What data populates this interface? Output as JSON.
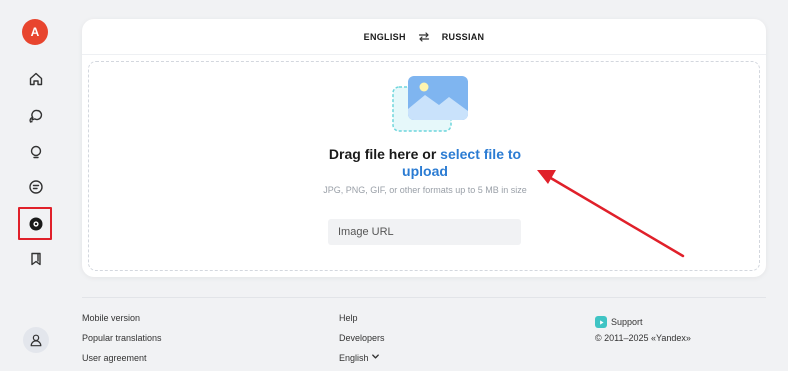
{
  "app": {
    "logo_text": "A"
  },
  "sidebar": {
    "items": [
      {
        "name": "home",
        "icon": "home-icon"
      },
      {
        "name": "text-translation",
        "icon": "chat-bubbles-icon"
      },
      {
        "name": "dialog",
        "icon": "lightbulb-icon"
      },
      {
        "name": "documents",
        "icon": "document-lines-icon"
      },
      {
        "name": "images",
        "icon": "camera-lens-icon",
        "active": true
      },
      {
        "name": "bookmarks",
        "icon": "bookmark-icon"
      }
    ],
    "highlight_color": "#e0202a"
  },
  "language_bar": {
    "source": "ENGLISH",
    "target": "RUSSIAN"
  },
  "upload": {
    "title_prefix": "Drag file here or ",
    "title_link": "select file to upload",
    "hint": "JPG, PNG, GIF, or other formats up to 5 MB in size",
    "url_placeholder": "Image URL",
    "url_value": ""
  },
  "footer": {
    "col1": [
      "Mobile version",
      "Popular translations",
      "User agreement"
    ],
    "col2_links": [
      "Help",
      "Developers"
    ],
    "language": "English",
    "support": "Support",
    "copyright": "© 2011–2025 «Yandex»"
  },
  "colors": {
    "accent": "#2b7cd3",
    "logo": "#e8452e",
    "annotation": "#e0202a"
  }
}
